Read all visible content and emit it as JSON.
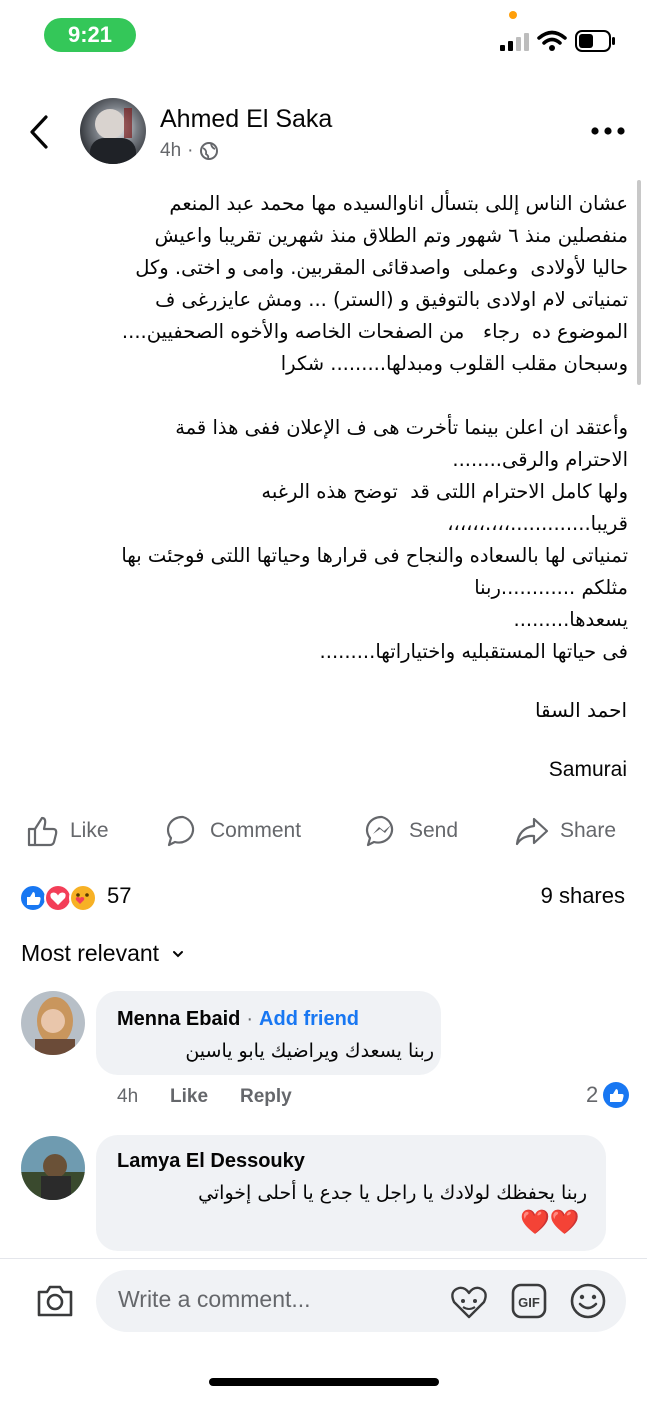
{
  "status_bar": {
    "time": "9:21"
  },
  "post": {
    "author": "Ahmed El Saka",
    "time": "4h",
    "body_lines": [
      "عشان الناس إللى بتسأل اناوالسيده مها محمد عبد المنعم",
      "منفصلين منذ ٦ شهور وتم الطلاق منذ شهرين تقريبا واعيش",
      "حاليا لأولادى  وعملى  واصدقائى المقربين. وامى و اختى. وكل",
      "تمنياتى لام اولادى بالتوفيق و (الستر) ... ومش عايزرغى ف",
      "الموضوع ده  رجاء   من الصفحات الخاصه والأخوه الصحفيين....",
      "وسبحان مقلب القلوب ومبدلها......... شكرا",
      "",
      "وأعتقد ان اعلن بينما تأخرت هى ف الإعلان ففى هذا قمة",
      "الاحترام والرقى........",
      "ولها كامل الاحترام اللتى قد  توضح هذه الرغبه",
      "قريبا.............،،،.،،،،،،",
      "تمنياتى لها بالسعاده والنجاح فى قرارها وحياتها اللتى فوجئت بها",
      "مثلكم ............ربنا",
      "يسعدها.........",
      "فى حياتها المستقبليه واختياراتها........."
    ],
    "signature_ar": "احمد السقا",
    "signature_en": "Samurai"
  },
  "actions": {
    "like": "Like",
    "comment": "Comment",
    "send": "Send",
    "share": "Share"
  },
  "stats": {
    "reactions_count": "57",
    "shares": "9 shares"
  },
  "sort_label": "Most relevant",
  "comments": [
    {
      "name": "Menna Ebaid",
      "add_friend": "Add friend",
      "text": "ربنا يسعدك ويراضيك يابو ياسين",
      "time": "4h",
      "like": "Like",
      "reply": "Reply",
      "reactions": "2"
    },
    {
      "name": "Lamya El Dessouky",
      "text": "ربنا يحفظك لولادك يا راجل يا جدع يا أحلى إخواتي",
      "hearts": "❤️❤️"
    }
  ],
  "composer": {
    "placeholder": "Write a comment..."
  },
  "colors": {
    "accent": "#1877f2",
    "status_green": "#34c759",
    "secondary_text": "#65676b",
    "bubble": "#f0f2f5"
  }
}
